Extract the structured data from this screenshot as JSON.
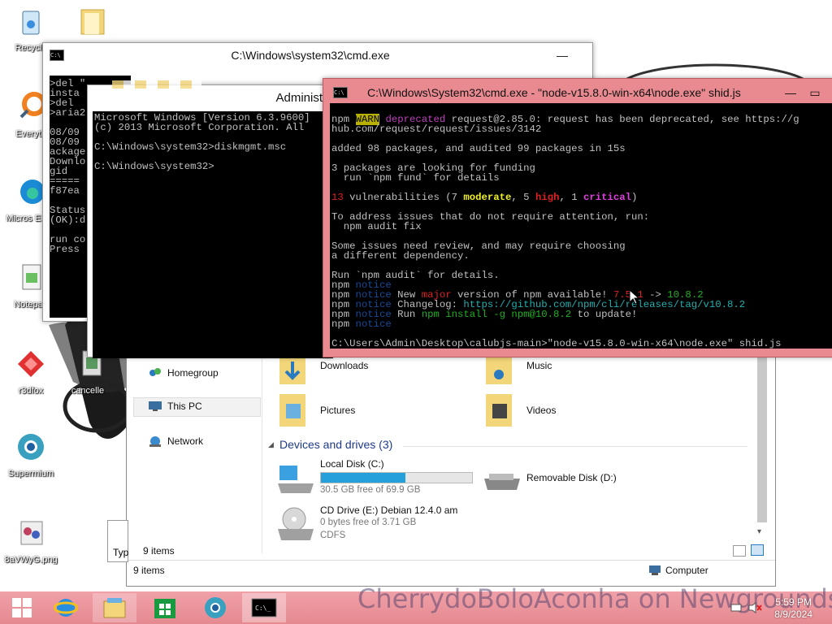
{
  "desktop": {
    "icons": [
      {
        "label": "Recycle"
      },
      {
        "label": "Everyth"
      },
      {
        "label": "Micros Edge"
      },
      {
        "label": "Notepad"
      },
      {
        "label": "r3dfox"
      },
      {
        "label": "cancelle"
      },
      {
        "label": "Supermium"
      },
      {
        "label": "8aVWyG.png"
      }
    ]
  },
  "cmd_back": {
    "title": "C:\\Windows\\system32\\cmd.exe",
    "lines": [
      ">del \"",
      "insta",
      ">del ",
      ">aria2",
      "",
      "08/09",
      "08/09",
      "ackage",
      "Downlo",
      "gid",
      "=====",
      "f87ea",
      "",
      "Status",
      "(OK):d",
      "",
      "run co",
      "Press"
    ]
  },
  "cmd_admin": {
    "title": "Administr",
    "lines": [
      "Microsoft Windows [Version 6.3.9600]",
      "(c) 2013 Microsoft Corporation. All",
      "",
      "C:\\Windows\\system32>diskmgmt.msc",
      "",
      "C:\\Windows\\system32>"
    ]
  },
  "cmd_node": {
    "title": "C:\\Windows\\System32\\cmd.exe - \"node-v15.8.0-win-x64\\node.exe\"  shid.js",
    "l1_npm": "npm ",
    "l1_warn": "WARN",
    "l1_dep": " deprecated",
    "l1_rest": " request@2.85.0: request has been deprecated, see https://g",
    "l2": "hub.com/request/request/issues/3142",
    "l3": "added 98 packages, and audited 99 packages in 15s",
    "l4": "3 packages are looking for funding",
    "l5": "  run `npm fund` for details",
    "vuln_num": "13",
    "vuln_a": " vulnerabilities (7 ",
    "vuln_mod": "moderate",
    "vuln_b": ", 5 ",
    "vuln_high": "high",
    "vuln_c": ", 1 ",
    "vuln_crit": "critical",
    "vuln_d": ")",
    "l7": "To address issues that do not require attention, run:",
    "l8": "  npm audit fix",
    "l9": "Some issues need review, and may require choosing",
    "l10": "a different dependency.",
    "l11": "Run `npm audit` for details.",
    "npm": "npm",
    "notice": " notice",
    "n2_a": " New ",
    "n2_major": "major",
    "n2_b": " version of npm available! ",
    "n2_old": "7.5.1",
    "n2_arrow": " -> ",
    "n2_new": "10.8.2",
    "n3_a": " Changelog: ",
    "n3_url": "https://github.com/npm/cli/releases/tag/v10.8.2",
    "n4_a": " Run ",
    "n4_cmd": "npm install -g npm@10.8.2",
    "n4_b": " to update!",
    "prompt": "C:\\Users\\Admin\\Desktop\\calubjs-main>\"node-v15.8.0-win-x64\\node.exe\" shid.js"
  },
  "explorer": {
    "nav": {
      "homegroup": "Homegroup",
      "this_pc": "This PC",
      "network": "Network"
    },
    "folders": {
      "downloads": "Downloads",
      "music": "Music",
      "pictures": "Pictures",
      "videos": "Videos"
    },
    "devices_header": "Devices and drives (3)",
    "drives": [
      {
        "name": "Local Disk (C:)",
        "free": "30.5 GB free of 69.9 GB",
        "used_fraction": 0.56
      },
      {
        "name": "Removable Disk (D:)"
      },
      {
        "name": "CD Drive (E:) Debian 12.4.0 am",
        "free": "0 bytes free of 3.71 GB",
        "fs": "CDFS"
      }
    ],
    "items_inner": "9 items",
    "items_outer": "9 items",
    "computer": "Computer"
  },
  "taskbar": {
    "time": "5:59 PM",
    "date": "8/9/2024",
    "watermark": "CherrydoBoloAconha on Newgrounds."
  },
  "colors": {
    "node_titlebar": "#e98a91",
    "taskbar": "#e88c93",
    "warn_bg": "#b8b000",
    "magenta": "#c040c0",
    "red": "#e02020",
    "yellow": "#f0f020",
    "green": "#20b020",
    "cyan": "#20b0b0"
  }
}
